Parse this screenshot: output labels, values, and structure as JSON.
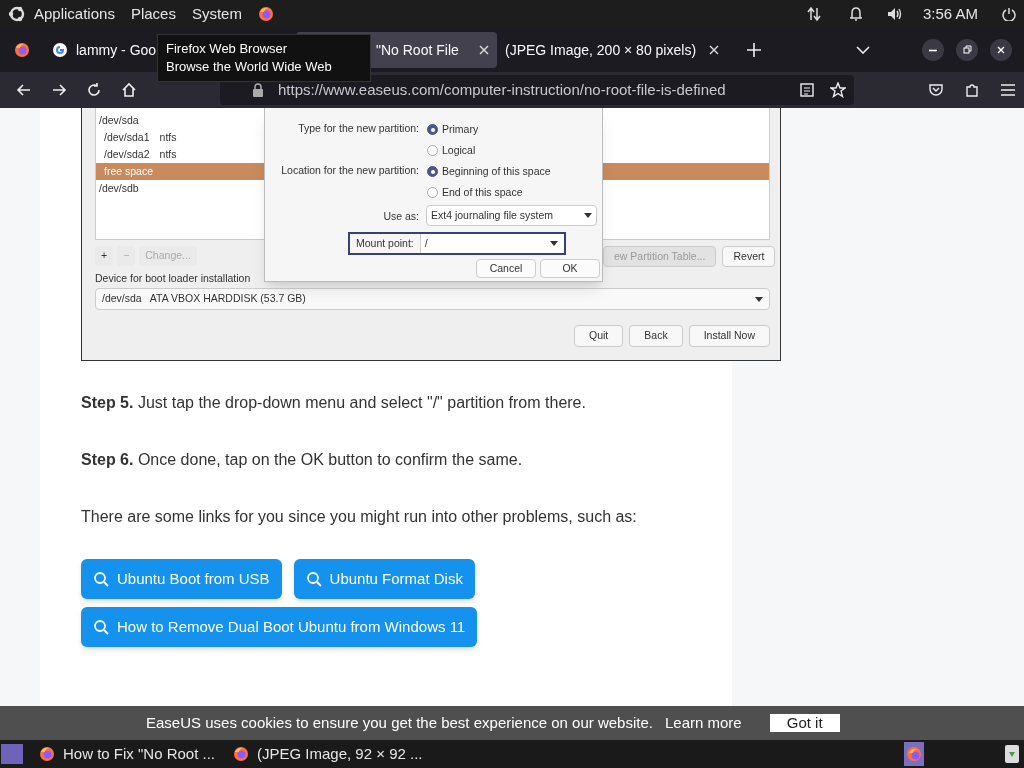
{
  "top_panel": {
    "menus": [
      "Applications",
      "Places",
      "System"
    ],
    "clock": "3:56 AM"
  },
  "tabs": [
    {
      "title": "lammy - Goo",
      "selected": false,
      "kind": "google"
    },
    {
      "title": "\"No Root File",
      "selected": true,
      "kind": "page"
    },
    {
      "title": "(JPEG Image, 200 × 80 pixels)",
      "selected": false,
      "kind": "page"
    }
  ],
  "tooltip": {
    "title": "Firefox Web Browser",
    "subtitle": "Browse the World Wide Web"
  },
  "address_bar": {
    "url": "https://www.easeus.com/computer-instruction/no-root-file-is-defined"
  },
  "installer": {
    "partitions": [
      {
        "device": "/dev/sda",
        "selected": false,
        "children": [
          {
            "device": "/dev/sda1",
            "type": "ntfs",
            "selected": false
          },
          {
            "device": "/dev/sda2",
            "type": "ntfs",
            "selected": false
          },
          {
            "device": "free space",
            "selected": true
          }
        ]
      },
      {
        "device": "/dev/sdb",
        "selected": false
      }
    ],
    "list_buttons": [
      "+",
      "−",
      "Change..."
    ],
    "right_buttons": [
      "ew Partition Table...",
      "Revert"
    ],
    "boot_label": "Device for boot loader installation",
    "boot_device": "/dev/sda   ATA VBOX HARDDISK (53.7 GB)",
    "buttons": [
      "Quit",
      "Back",
      "Install Now"
    ],
    "dialog": {
      "type_label": "Type for the new partition:",
      "type_options": [
        {
          "label": "Primary",
          "selected": true
        },
        {
          "label": "Logical",
          "selected": false
        }
      ],
      "location_label": "Location for the new partition:",
      "location_options": [
        {
          "label": "Beginning of this space",
          "selected": true
        },
        {
          "label": "End of this space",
          "selected": false
        }
      ],
      "use_as_label": "Use as:",
      "use_as": "Ext4 journaling file system",
      "mount_label": "Mount point:",
      "mount_value": "/",
      "buttons": [
        "Cancel",
        "OK"
      ]
    }
  },
  "paragraphs": [
    "**Step 5.** Just tap the drop-down menu and select \"/\" partition from there.",
    "**Step 6.** Once done, tap on the OK button to confirm the same.",
    "There are some links for you since you might run into other problems, such as:"
  ],
  "links": [
    "Ubuntu Boot from USB",
    "Ubuntu Format Disk",
    "How to Remove Dual Boot Ubuntu from Windows 11"
  ],
  "cookie_bar": {
    "text": "EaseUS uses cookies to ensure you get the best experience on our website.",
    "link": "Learn more",
    "button": "Got it"
  },
  "taskbar": [
    {
      "title": "How to Fix \"No Root ..."
    },
    {
      "title": "(JPEG Image, 92 × 92 ..."
    }
  ]
}
